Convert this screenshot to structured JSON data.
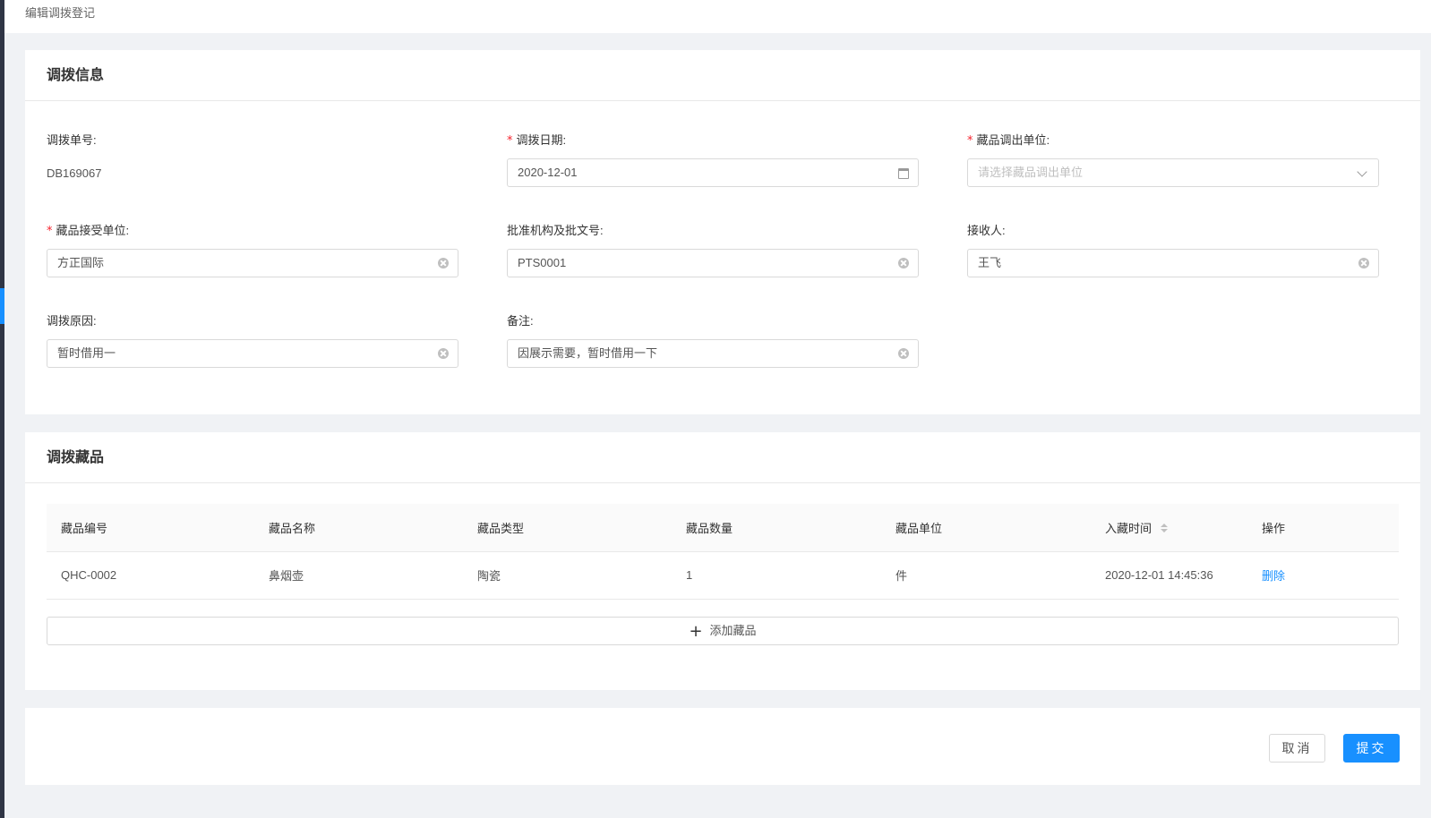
{
  "breadcrumb": "编辑调拨登记",
  "info_card": {
    "title": "调拨信息",
    "fields": [
      {
        "label": "调拨单号:",
        "required": false,
        "value": "DB169067"
      },
      {
        "label": "调拨日期:",
        "required": true,
        "value": "2020-12-01"
      },
      {
        "label": "藏品调出单位:",
        "required": true,
        "value": "",
        "placeholder": "请选择藏品调出单位"
      },
      {
        "label": "藏品接受单位:",
        "required": true,
        "value": "方正国际"
      },
      {
        "label": "批准机构及批文号:",
        "required": false,
        "value": "PTS0001"
      },
      {
        "label": "接收人:",
        "required": false,
        "value": "王飞"
      },
      {
        "label": "调拨原因:",
        "required": false,
        "value": "暂时借用一"
      },
      {
        "label": "备注:",
        "required": false,
        "value": "因展示需要，暂时借用一下"
      }
    ],
    "required_mark": "*"
  },
  "items_card": {
    "title": "调拨藏品",
    "columns": [
      "藏品编号",
      "藏品名称",
      "藏品类型",
      "藏品数量",
      "藏品单位",
      "入藏时间",
      "操作"
    ],
    "rows": [
      {
        "code": "QHC-0002",
        "name": "鼻烟壶",
        "type": "陶瓷",
        "qty": "1",
        "unit": "件",
        "time": "2020-12-01 14:45:36",
        "action": "删除"
      }
    ],
    "add_label": "添加藏品",
    "add_icon": "+"
  },
  "footer": {
    "cancel_label": "取消",
    "submit_label": "提交"
  },
  "colors": {
    "primary": "#1890ff",
    "required": "#f5222d",
    "sidebar": "#2f3545"
  }
}
